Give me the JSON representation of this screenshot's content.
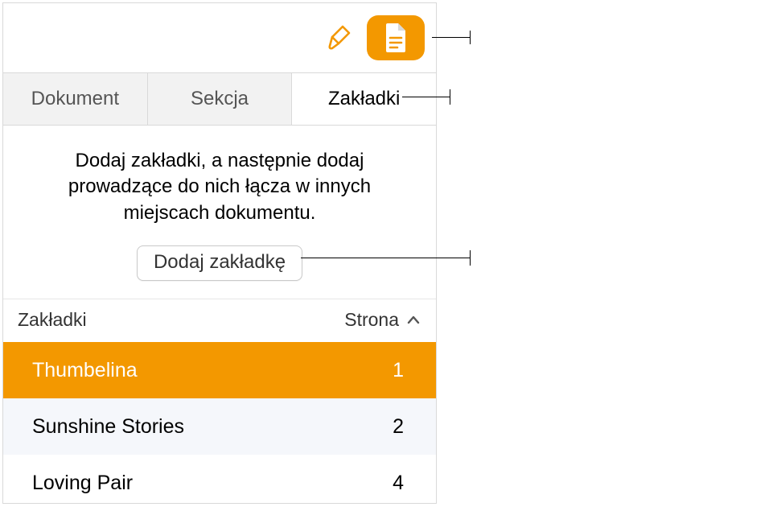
{
  "toolbar": {
    "brush_icon": "format-brush-icon",
    "doc_icon": "document-icon"
  },
  "tabs": {
    "items": [
      {
        "label": "Dokument",
        "active": false
      },
      {
        "label": "Sekcja",
        "active": false
      },
      {
        "label": "Zakładki",
        "active": true
      }
    ]
  },
  "description": "Dodaj zakładki, a następnie dodaj prowadzące do nich łącza w innych miejscach dokumentu.",
  "add_button_label": "Dodaj zakładkę",
  "list_header": {
    "name_label": "Zakładki",
    "page_label": "Strona"
  },
  "bookmarks": [
    {
      "name": "Thumbelina",
      "page": "1",
      "selected": true
    },
    {
      "name": "Sunshine Stories",
      "page": "2",
      "selected": false
    },
    {
      "name": "Loving Pair",
      "page": "4",
      "selected": false
    }
  ]
}
